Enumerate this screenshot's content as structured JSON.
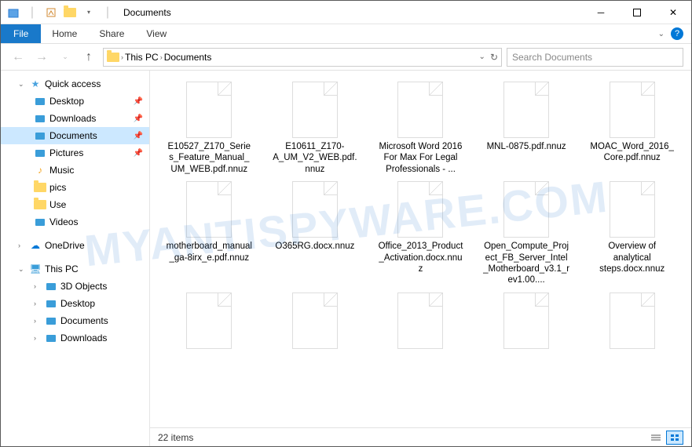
{
  "titlebar": {
    "title": "Documents"
  },
  "ribbon": {
    "file": "File",
    "tabs": [
      "Home",
      "Share",
      "View"
    ]
  },
  "nav": {
    "breadcrumb": [
      "This PC",
      "Documents"
    ],
    "searchPlaceholder": "Search Documents"
  },
  "sidebar": {
    "quickAccess": {
      "label": "Quick access",
      "items": [
        {
          "label": "Desktop",
          "icon": "desktop",
          "pinned": true
        },
        {
          "label": "Downloads",
          "icon": "downloads",
          "pinned": true
        },
        {
          "label": "Documents",
          "icon": "documents",
          "pinned": true,
          "selected": true
        },
        {
          "label": "Pictures",
          "icon": "pictures",
          "pinned": true
        },
        {
          "label": "Music",
          "icon": "music",
          "pinned": false
        },
        {
          "label": "pics",
          "icon": "folder",
          "pinned": false
        },
        {
          "label": "Use",
          "icon": "folder",
          "pinned": false
        },
        {
          "label": "Videos",
          "icon": "videos",
          "pinned": false
        }
      ]
    },
    "oneDrive": {
      "label": "OneDrive"
    },
    "thisPC": {
      "label": "This PC",
      "items": [
        {
          "label": "3D Objects",
          "icon": "3d"
        },
        {
          "label": "Desktop",
          "icon": "desktop"
        },
        {
          "label": "Documents",
          "icon": "documents"
        },
        {
          "label": "Downloads",
          "icon": "downloads"
        }
      ]
    }
  },
  "files": [
    {
      "name": "E10527_Z170_Series_Feature_Manual_UM_WEB.pdf.nnuz"
    },
    {
      "name": "E10611_Z170-A_UM_V2_WEB.pdf.nnuz"
    },
    {
      "name": "Microsoft Word 2016 For Max For Legal Professionals - ..."
    },
    {
      "name": "MNL-0875.pdf.nnuz"
    },
    {
      "name": "MOAC_Word_2016_Core.pdf.nnuz"
    },
    {
      "name": "motherboard_manual_ga-8irx_e.pdf.nnuz"
    },
    {
      "name": "O365RG.docx.nnuz"
    },
    {
      "name": "Office_2013_Product_Activation.docx.nnuz"
    },
    {
      "name": "Open_Compute_Project_FB_Server_Intel_Motherboard_v3.1_rev1.00...."
    },
    {
      "name": "Overview of analytical steps.docx.nnuz"
    },
    {
      "name": ""
    },
    {
      "name": ""
    },
    {
      "name": ""
    },
    {
      "name": ""
    },
    {
      "name": ""
    }
  ],
  "status": {
    "count": "22 items"
  },
  "watermark": "MYANTISPYWARE.COM"
}
